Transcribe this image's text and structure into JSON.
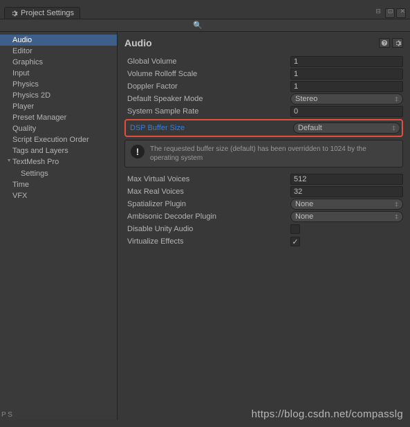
{
  "window": {
    "title": "Project Settings"
  },
  "sidebar": {
    "items": [
      {
        "label": "Audio",
        "selected": true
      },
      {
        "label": "Editor"
      },
      {
        "label": "Graphics"
      },
      {
        "label": "Input"
      },
      {
        "label": "Physics"
      },
      {
        "label": "Physics 2D"
      },
      {
        "label": "Player"
      },
      {
        "label": "Preset Manager"
      },
      {
        "label": "Quality"
      },
      {
        "label": "Script Execution Order"
      },
      {
        "label": "Tags and Layers"
      },
      {
        "label": "TextMesh Pro",
        "parent": true
      },
      {
        "label": "Settings",
        "child": true
      },
      {
        "label": "Time"
      },
      {
        "label": "VFX"
      }
    ]
  },
  "content": {
    "title": "Audio",
    "props": {
      "global_volume": {
        "label": "Global Volume",
        "value": "1"
      },
      "volume_rolloff": {
        "label": "Volume Rolloff Scale",
        "value": "1"
      },
      "doppler_factor": {
        "label": "Doppler Factor",
        "value": "1"
      },
      "speaker_mode": {
        "label": "Default Speaker Mode",
        "value": "Stereo"
      },
      "sample_rate": {
        "label": "System Sample Rate",
        "value": "0"
      },
      "dsp_buffer": {
        "label": "DSP Buffer Size",
        "value": "Default"
      },
      "info_msg": "The requested buffer size (default) has been overridden to 1024 by the operating system",
      "max_virtual": {
        "label": "Max Virtual Voices",
        "value": "512"
      },
      "max_real": {
        "label": "Max Real Voices",
        "value": "32"
      },
      "spatializer": {
        "label": "Spatializer Plugin",
        "value": "None"
      },
      "ambisonic": {
        "label": "Ambisonic Decoder Plugin",
        "value": "None"
      },
      "disable_audio": {
        "label": "Disable Unity Audio",
        "checked": false
      },
      "virtualize": {
        "label": "Virtualize Effects",
        "checked": true
      }
    }
  },
  "watermark": "https://blog.csdn.net/compasslg",
  "watermark_left": "P\nS"
}
